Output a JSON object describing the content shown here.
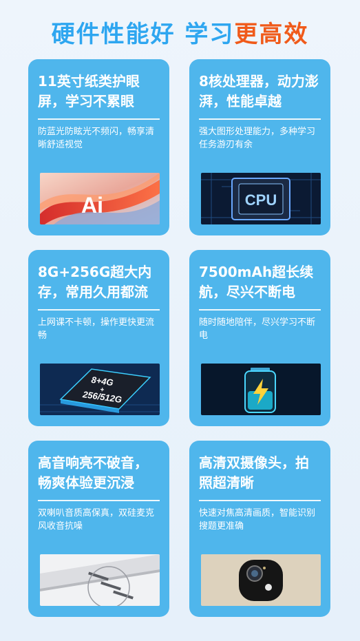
{
  "header": {
    "title_part1": "硬件性能好 学习",
    "title_part2": "更高效"
  },
  "cards": [
    {
      "title": "11英寸纸类护眼屏，学习不累眼",
      "desc": "防蓝光防眩光不频闪，畅享清晰舒适视觉",
      "image_text": "Ai"
    },
    {
      "title": "8核处理器，动力澎湃，性能卓越",
      "desc": "强大图形处理能力，多种学习任务游刃有余",
      "image_text": "CPU"
    },
    {
      "title": "8G+256G超大内存，常用久用都流畅",
      "desc": "上网课不卡顿，操作更快更流畅",
      "image_text_line1": "8+4G",
      "image_text_line2": "+",
      "image_text_line3": "256/512G"
    },
    {
      "title": "7500mAh超长续航，尽兴不断电",
      "desc": "随时随地陪伴，尽兴学习不断电"
    },
    {
      "title": "高音响亮不破音，畅爽体验更沉浸",
      "desc": "双喇叭音质高保真，双硅麦克风收音抗噪"
    },
    {
      "title": "高清双摄像头，拍照超清晰",
      "desc": "快速对焦高清画质，智能识别搜题更准确"
    }
  ]
}
